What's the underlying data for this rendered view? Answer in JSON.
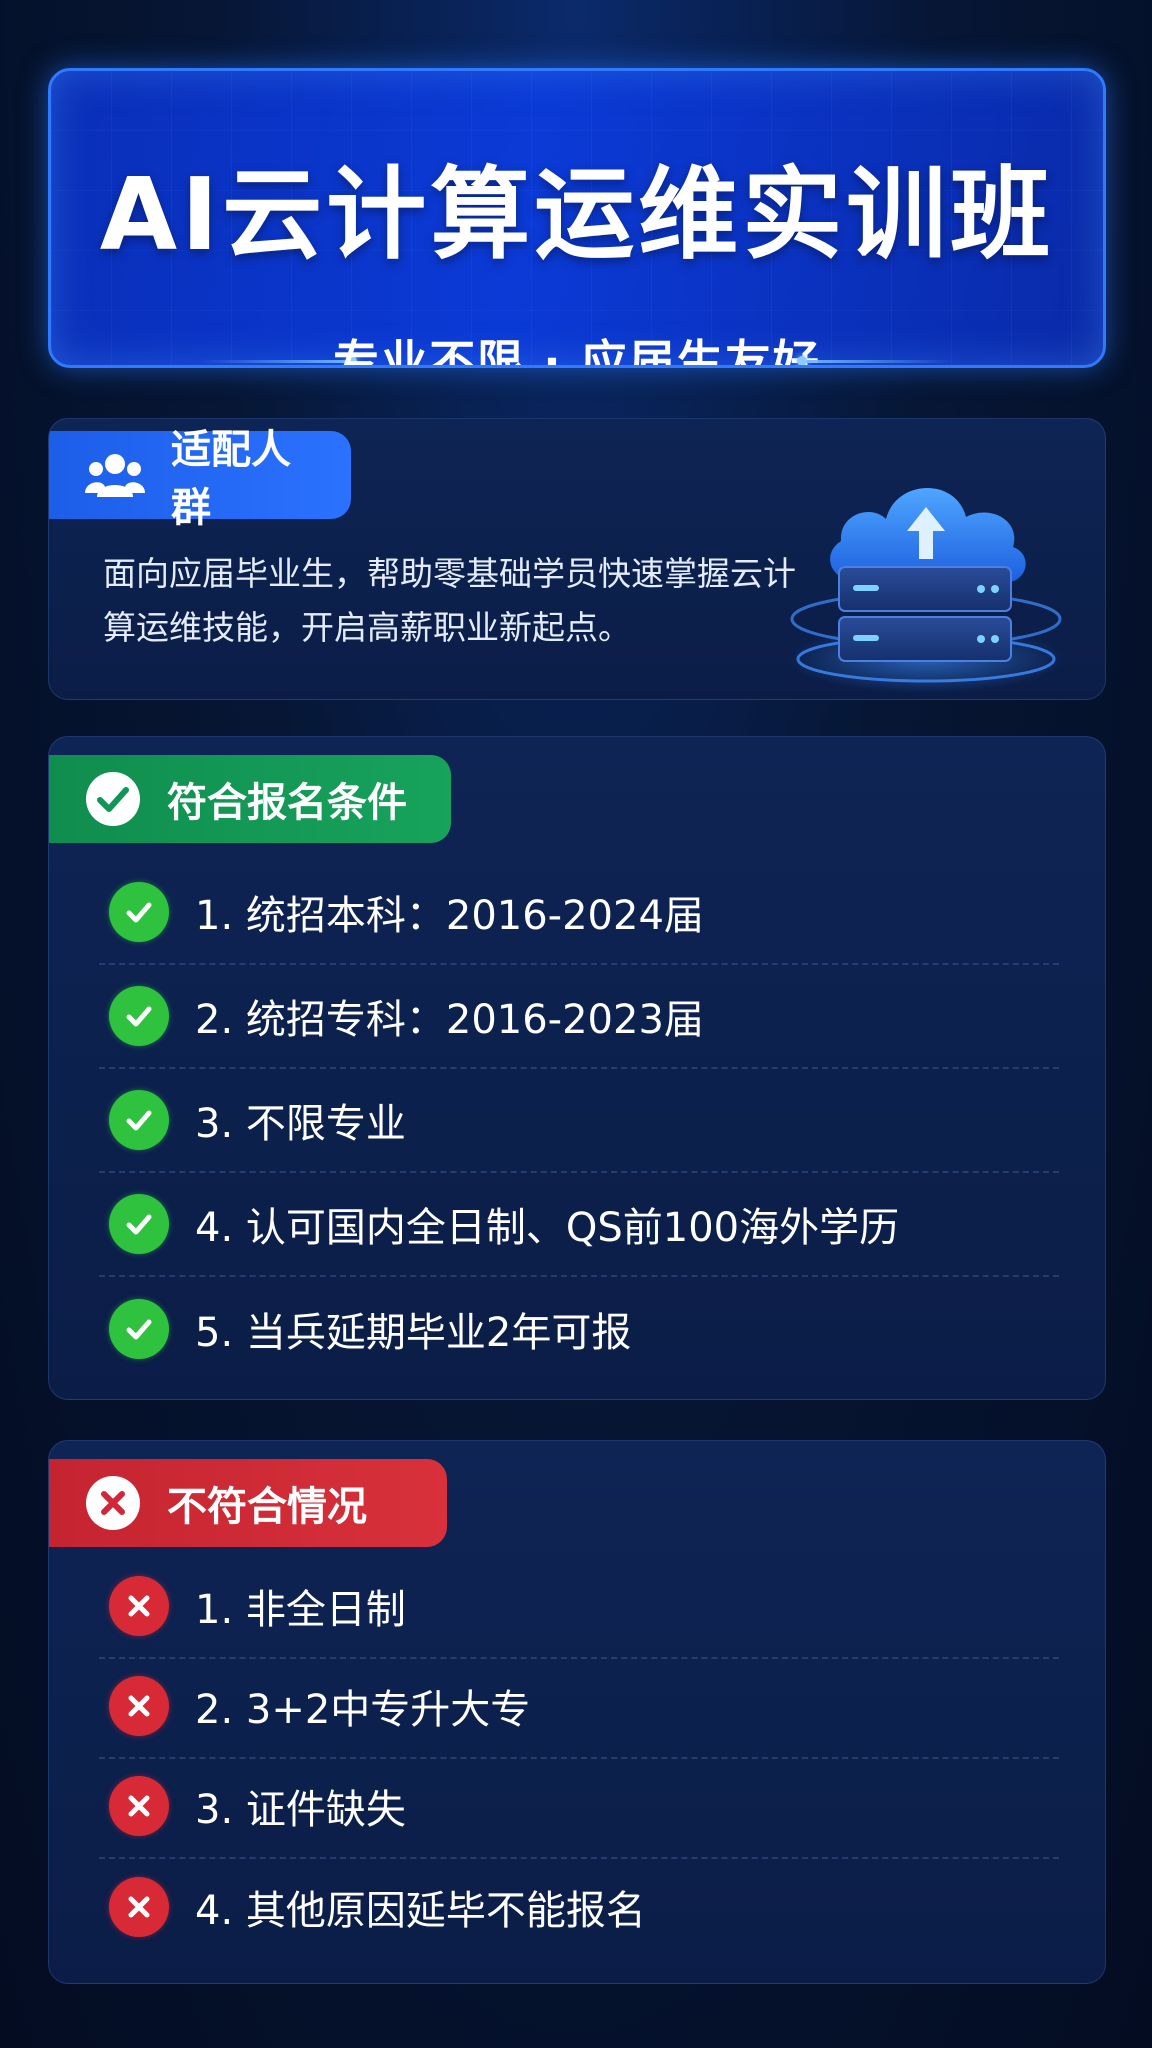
{
  "banner": {
    "title": "AI云计算运维实训班",
    "subtitle": "专业不限 · 应届生友好"
  },
  "audience": {
    "tag": "适配人群",
    "icon": "users-icon",
    "text": "面向应届毕业生，帮助零基础学员快速掌握云计算运维技能，开启高薪职业新起点。"
  },
  "eligible": {
    "tag": "符合报名条件",
    "icon": "check-circle-icon",
    "items": [
      "1. 统招本科：2016-2024届",
      "2. 统招专科：2016-2023届",
      "3. 不限专业",
      "4. 认可国内全日制、QS前100海外学历",
      "5. 当兵延期毕业2年可报"
    ]
  },
  "ineligible": {
    "tag": "不符合情况",
    "icon": "x-circle-icon",
    "items": [
      "1. 非全日制",
      "2. 3+2中专升大专",
      "3. 证件缺失",
      "4. 其他原因延毕不能报名"
    ]
  },
  "colors": {
    "background": "#061634",
    "card": "#0e2454",
    "blue": "#2a72ff",
    "green": "#17a35c",
    "red": "#d8313b"
  }
}
